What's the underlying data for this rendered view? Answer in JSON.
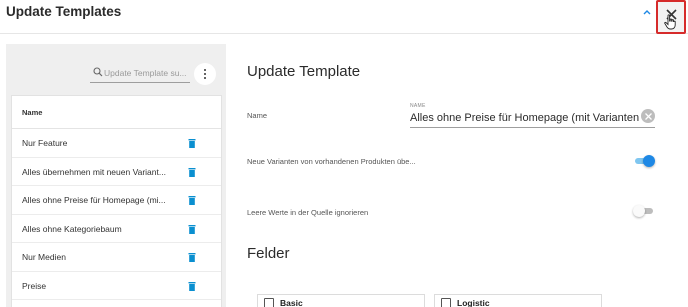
{
  "header": {
    "title": "Update Templates",
    "collapse_icon": "chevron-up-icon",
    "close_icon": "close-icon"
  },
  "sidebar": {
    "search": {
      "placeholder": "Update Template su..."
    },
    "menu_icon": "more-vert-icon",
    "table": {
      "header": "Name",
      "rows": [
        {
          "label": "Nur Feature"
        },
        {
          "label": "Alles übernehmen mit neuen Variant..."
        },
        {
          "label": "Alles ohne Preise für Homepage (mi..."
        },
        {
          "label": "Alles ohne Kategoriebaum"
        },
        {
          "label": "Nur Medien"
        },
        {
          "label": "Preise"
        }
      ]
    }
  },
  "form": {
    "title": "Update Template",
    "name": {
      "label": "Name",
      "caption": "NAME",
      "value": "Alles ohne Preise für Homepage (mit Varianten und Kate"
    },
    "new_variants": {
      "label": "Neue Varianten von vorhandenen Produkten übe...",
      "enabled": true
    },
    "ignore_empty": {
      "label": "Leere Werte in der Quelle ignorieren",
      "enabled": false
    },
    "fields_title": "Felder",
    "field_groups": [
      {
        "label": "Basic",
        "checked": false
      },
      {
        "label": "Logistic",
        "checked": false
      }
    ]
  },
  "colors": {
    "accent": "#1e88e5",
    "delete_icon": "#0a8fd0",
    "close_highlight": "#d62b2b"
  }
}
